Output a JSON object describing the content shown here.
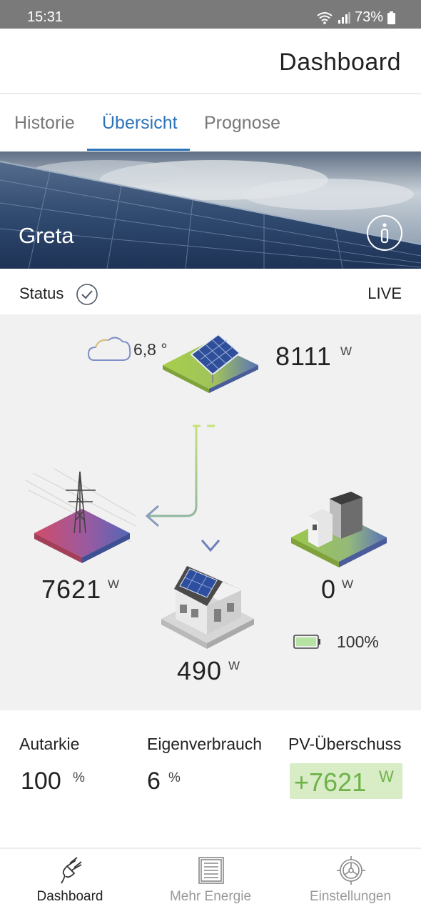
{
  "statusbar": {
    "time": "15:31",
    "battery": "73%"
  },
  "appbar": {
    "title": "Dashboard"
  },
  "tabs": [
    {
      "label": "Historie",
      "active": false
    },
    {
      "label": "Übersicht",
      "active": true
    },
    {
      "label": "Prognose",
      "active": false
    }
  ],
  "banner": {
    "name": "Greta"
  },
  "status": {
    "label": "Status",
    "live": "LIVE"
  },
  "flow": {
    "weather": {
      "temperature": "6,8 °"
    },
    "pv": {
      "value": "8111",
      "unit": "W"
    },
    "grid": {
      "value": "7621",
      "unit": "W"
    },
    "house": {
      "value": "490",
      "unit": "W"
    },
    "storage": {
      "value": "0",
      "unit": "W"
    },
    "battery": {
      "percent": "100%"
    }
  },
  "stats": {
    "autarkie": {
      "label": "Autarkie",
      "value": "100",
      "unit": "%"
    },
    "eigenverbrauch": {
      "label": "Eigenverbrauch",
      "value": "6",
      "unit": "%"
    },
    "pv_ueberschuss": {
      "label": "PV-Überschuss",
      "value": "+7621",
      "unit": "W",
      "color": "#6eb24a"
    }
  },
  "nav": [
    {
      "label": "Dashboard",
      "icon": "plug-icon",
      "active": true
    },
    {
      "label": "Mehr Energie",
      "icon": "document-icon",
      "active": false
    },
    {
      "label": "Einstellungen",
      "icon": "settings-wheel-icon",
      "active": false
    }
  ],
  "colors": {
    "accent": "#2d73b9",
    "green": "#6eb24a",
    "flow_green": "#a6cf5a",
    "flow_blue": "#6f7fb8"
  }
}
